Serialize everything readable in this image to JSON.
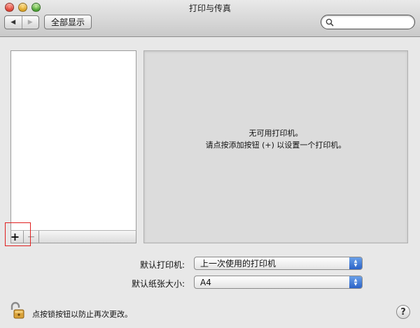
{
  "window": {
    "title": "打印与传真"
  },
  "toolbar": {
    "back_icon": "◀",
    "forward_icon": "▶",
    "show_all_label": "全部显示",
    "search": {
      "value": "",
      "placeholder": ""
    }
  },
  "printer_list": {
    "items": [],
    "add_label": "+",
    "remove_label": "−"
  },
  "detail": {
    "line1": "无可用打印机。",
    "line2": "请点按添加按钮 (+) 以设置一个打印机。"
  },
  "settings": {
    "default_printer_label": "默认打印机:",
    "default_printer_value": "上一次使用的打印机",
    "default_paper_label": "默认纸张大小:",
    "default_paper_value": "A4"
  },
  "footer": {
    "lock_text": "点按锁按钮以防止再次更改。",
    "help_label": "?"
  },
  "colors": {
    "popup_arrow": "#2b63c8",
    "highlight": "#e02020"
  }
}
